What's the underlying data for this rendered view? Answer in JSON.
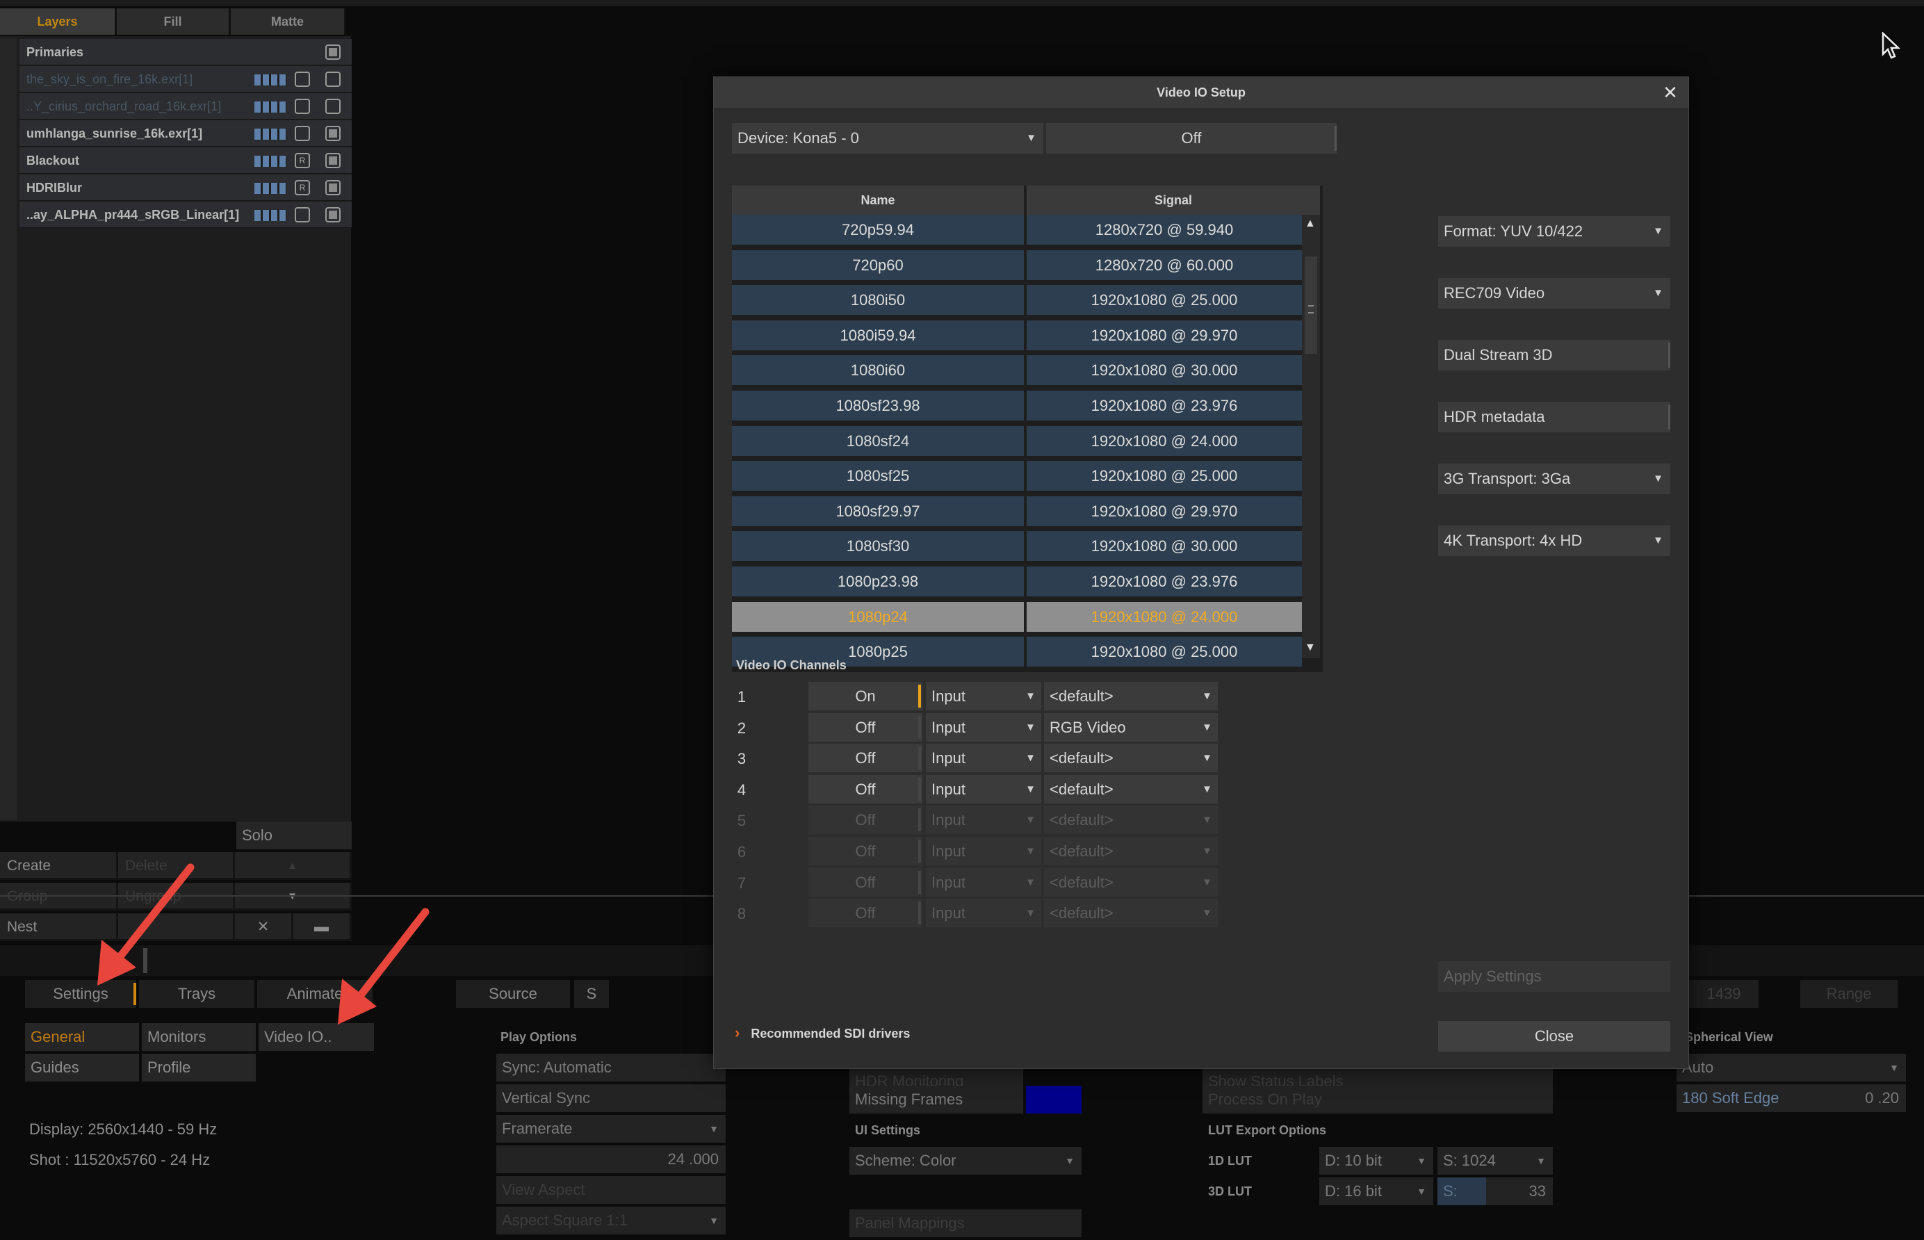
{
  "app": {
    "tabs": [
      "Layers",
      "Fill",
      "Matte"
    ],
    "layers_header": "Primaries",
    "layers": [
      {
        "name": "the_sky_is_on_fire_16k.exr[1]",
        "dim": true,
        "toggle": "box"
      },
      {
        "name": "..Y_cirius_orchard_road_16k.exr[1]",
        "dim": true,
        "toggle": "box"
      },
      {
        "name": "umhlanga_sunrise_16k.exr[1]",
        "dim": false,
        "toggle": "box"
      },
      {
        "name": "Blackout",
        "dim": false,
        "toggle": "R"
      },
      {
        "name": "HDRIBlur",
        "dim": false,
        "toggle": "R"
      },
      {
        "name": "..ay_ALPHA_pr444_sRGB_Linear[1]",
        "dim": false,
        "toggle": "box"
      }
    ],
    "solo_label": "Solo",
    "create_label": "Create",
    "delete_label": "Delete",
    "group_label": "Group",
    "ungroup_label": "Ungroup",
    "nest_label": "Nest",
    "bottom_tabs": [
      "Settings",
      "Trays",
      "Animate",
      "Source",
      "S"
    ],
    "settings_buttons": {
      "general": "General",
      "monitors": "Monitors",
      "video_io": "Video IO..",
      "guides": "Guides",
      "profile": "Profile"
    },
    "display_info": "Display: 2560x1440 - 59 Hz",
    "shot_info": "Shot   : 11520x5760 - 24 Hz",
    "play_options": {
      "header": "Play Options",
      "sync": "Sync: Automatic",
      "vertical_sync": "Vertical Sync",
      "framerate": "Framerate",
      "framerate_value": "24 .000",
      "view_aspect": "View Aspect",
      "aspect_square": "Aspect Square 1:1"
    },
    "middle": {
      "hdr_monitoring": "HDR Monitoring",
      "missing_frames": "Missing Frames",
      "missing_frames_color": "#00008b",
      "ui_settings_header": "UI Settings",
      "scheme": "Scheme: Color",
      "panel_mappings": "Panel Mappings"
    },
    "right": {
      "status_bar_labels": "Show Status Labels",
      "process_on_play": "Process On Play",
      "lut_export_header": "LUT Export Options",
      "lut_1d_label": "1D LUT",
      "lut_1d_depth": "D: 10 bit",
      "lut_1d_size": "S: 1024",
      "lut_3d_label": "3D LUT",
      "lut_3d_depth": "D: 16 bit",
      "lut_3d_size_label": "S:",
      "lut_3d_size": "33"
    },
    "spherical": {
      "header": "Spherical View",
      "mode": "Auto",
      "soft_edge_label": "180 Soft Edge",
      "soft_edge_value": "0 .20"
    },
    "frame_number": "1439",
    "range_label": "Range"
  },
  "dialog": {
    "title": "Video IO Setup",
    "device": "Device: Kona5 - 0",
    "device_state": "Off",
    "columns": [
      "Name",
      "Signal"
    ],
    "formats": [
      {
        "name": "720p59.94",
        "signal": "1280x720 @ 59.940"
      },
      {
        "name": "720p60",
        "signal": "1280x720 @ 60.000"
      },
      {
        "name": "1080i50",
        "signal": "1920x1080 @ 25.000"
      },
      {
        "name": "1080i59.94",
        "signal": "1920x1080 @ 29.970"
      },
      {
        "name": "1080i60",
        "signal": "1920x1080 @ 30.000"
      },
      {
        "name": "1080sf23.98",
        "signal": "1920x1080 @ 23.976"
      },
      {
        "name": "1080sf24",
        "signal": "1920x1080 @ 24.000"
      },
      {
        "name": "1080sf25",
        "signal": "1920x1080 @ 25.000"
      },
      {
        "name": "1080sf29.97",
        "signal": "1920x1080 @ 29.970"
      },
      {
        "name": "1080sf30",
        "signal": "1920x1080 @ 30.000"
      },
      {
        "name": "1080p23.98",
        "signal": "1920x1080 @ 23.976"
      },
      {
        "name": "1080p24",
        "signal": "1920x1080 @ 24.000",
        "selected": true
      },
      {
        "name": "1080p25",
        "signal": "1920x1080 @ 25.000"
      }
    ],
    "format": "Format: YUV 10/422",
    "colorspace": "REC709 Video",
    "dual_stream": "Dual Stream 3D",
    "hdr_metadata": "HDR metadata",
    "transport_3g": "3G Transport: 3Ga",
    "transport_4k": "4K Transport: 4x HD",
    "channels_label": "Video IO Channels",
    "channels": [
      {
        "num": "1",
        "state": "On",
        "io": "Input",
        "cs": "<default>",
        "enabled": true
      },
      {
        "num": "2",
        "state": "Off",
        "io": "Input",
        "cs": "RGB Video",
        "enabled": true
      },
      {
        "num": "3",
        "state": "Off",
        "io": "Input",
        "cs": "<default>",
        "enabled": true
      },
      {
        "num": "4",
        "state": "Off",
        "io": "Input",
        "cs": "<default>",
        "enabled": true
      },
      {
        "num": "5",
        "state": "Off",
        "io": "Input",
        "cs": "<default>",
        "enabled": false
      },
      {
        "num": "6",
        "state": "Off",
        "io": "Input",
        "cs": "<default>",
        "enabled": false
      },
      {
        "num": "7",
        "state": "Off",
        "io": "Input",
        "cs": "<default>",
        "enabled": false
      },
      {
        "num": "8",
        "state": "Off",
        "io": "Input",
        "cs": "<default>",
        "enabled": false
      }
    ],
    "apply_settings": "Apply Settings",
    "recommended": "Recommended SDI drivers",
    "close": "Close"
  },
  "annotation_color": "#e8463c",
  "icons": [
    "close-icon",
    "dropdown-arrow-icon",
    "scroll-up-icon",
    "scroll-down-icon",
    "chevron-right-icon",
    "mouse-cursor-icon",
    "annotation-arrow-icon"
  ]
}
